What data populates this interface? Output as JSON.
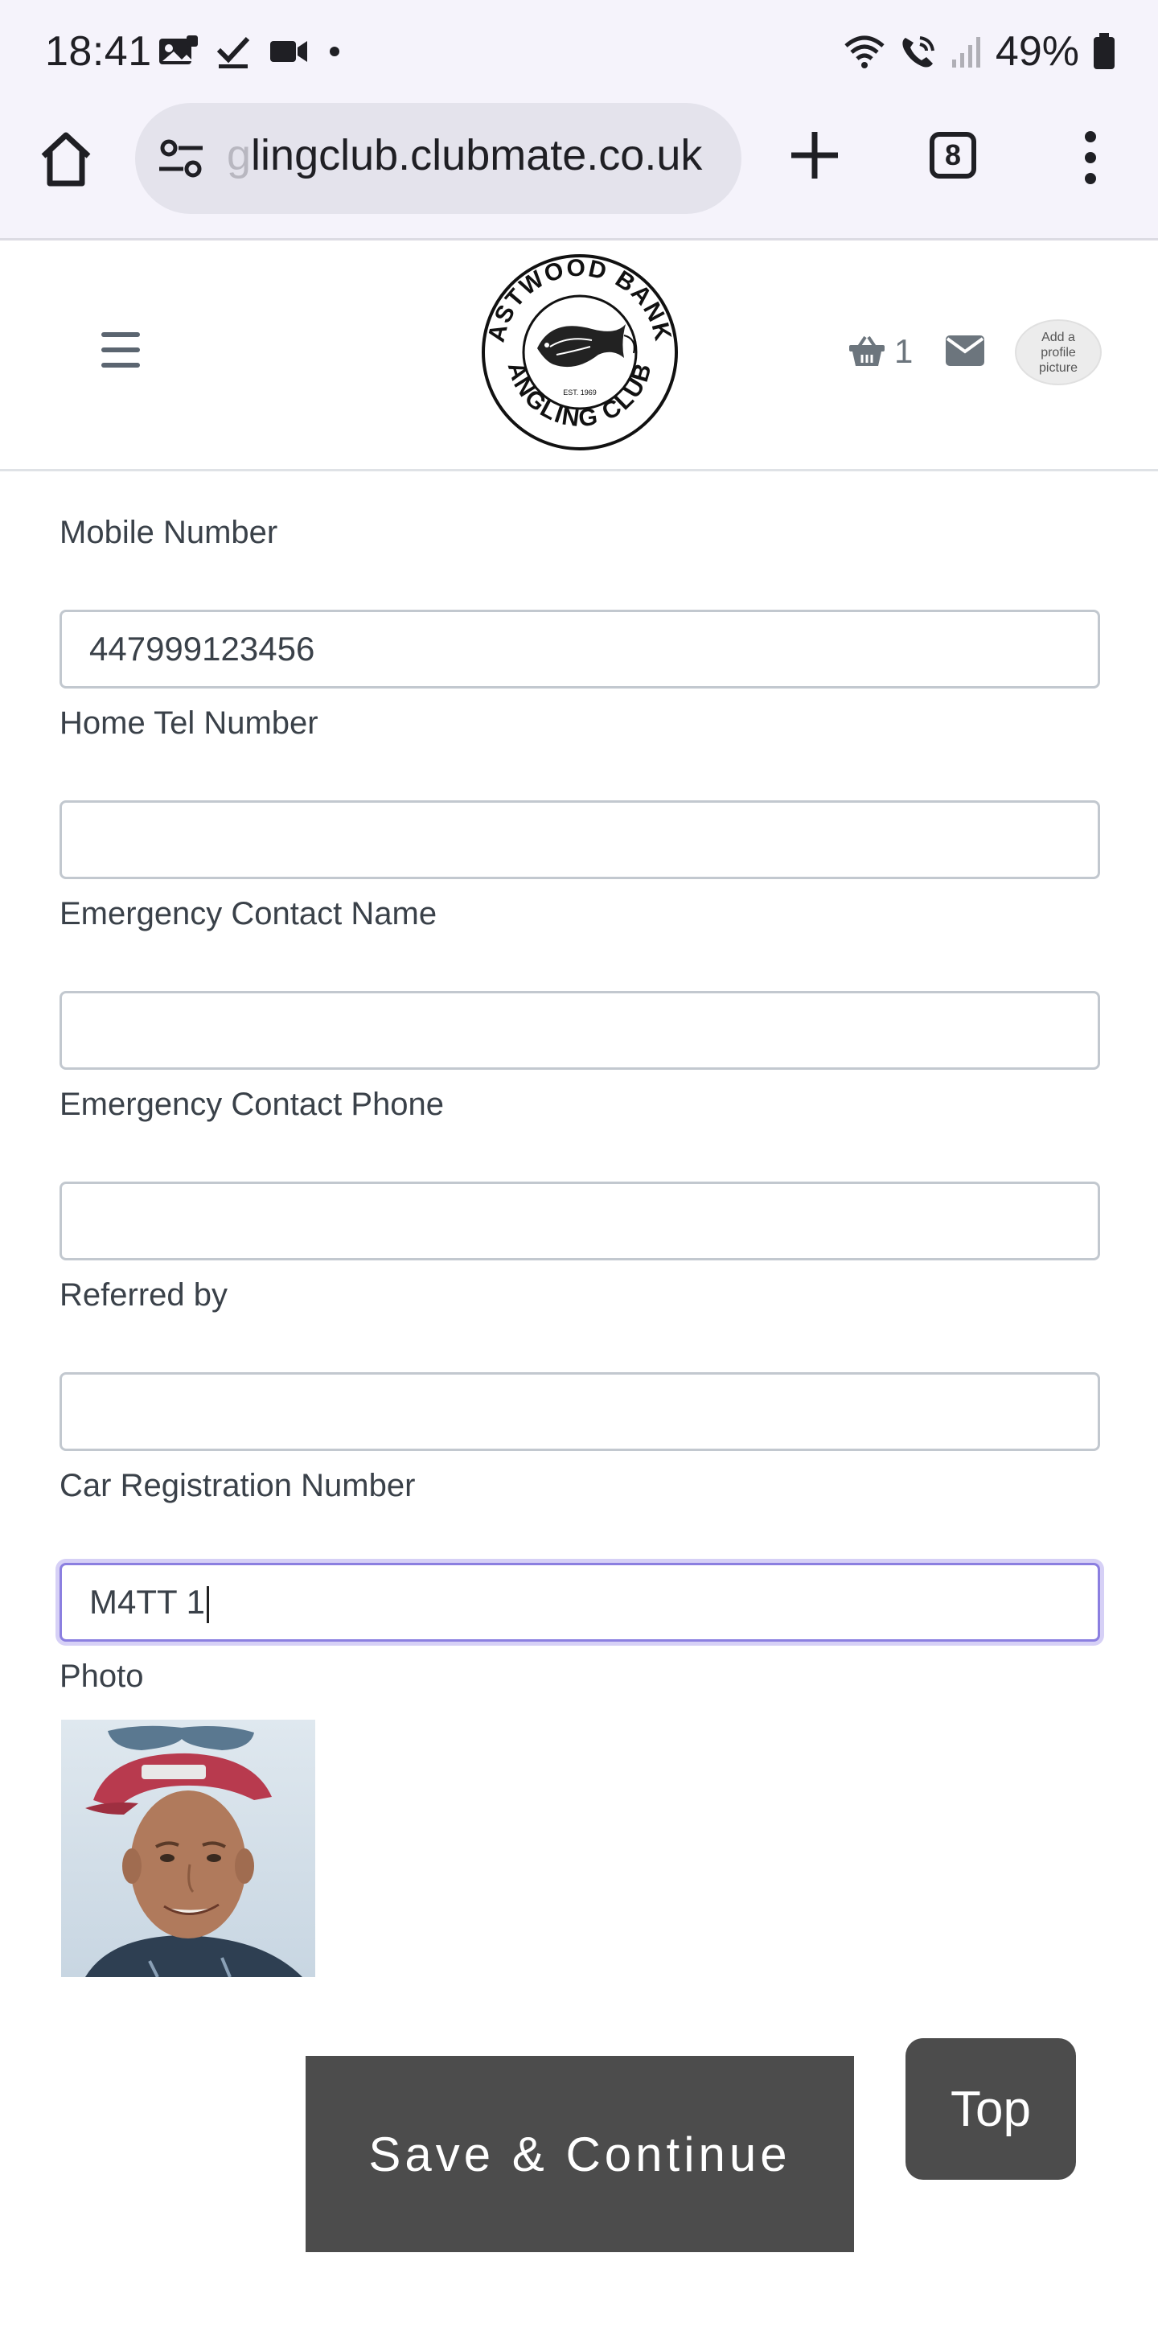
{
  "status_bar": {
    "time": "18:41",
    "battery": "49%",
    "icons_left": [
      "photo-notification-icon",
      "check-icon",
      "video-icon",
      "dot-icon"
    ],
    "icons_right": [
      "wifi-icon",
      "wifi-calling-icon",
      "signal-icon",
      "battery-icon"
    ]
  },
  "browser": {
    "url_faded_prefix": "g",
    "url": "lingclub.clubmate.co.uk",
    "tab_count": "8"
  },
  "header": {
    "logo_text_top": "ASTWOOD BANK",
    "logo_text_bottom": "ANGLING CLUB",
    "logo_est": "EST. 1969",
    "basket_count": "1",
    "avatar_text": "Add a profile picture"
  },
  "form": {
    "fields": [
      {
        "label": "Mobile Number",
        "value": "447999123456"
      },
      {
        "label": "Home Tel Number",
        "value": ""
      },
      {
        "label": "Emergency Contact Name",
        "value": ""
      },
      {
        "label": "Emergency Contact Phone",
        "value": ""
      },
      {
        "label": "Referred by",
        "value": ""
      },
      {
        "label": "Car Registration Number",
        "value": "M4TT 1"
      }
    ],
    "photo_label": "Photo"
  },
  "buttons": {
    "save_continue": "Save & Continue",
    "top": "Top"
  },
  "colors": {
    "button_bg": "#4c4c4c",
    "focus_ring": "#8b7fe0",
    "chrome_bg": "#f5f3fb"
  }
}
